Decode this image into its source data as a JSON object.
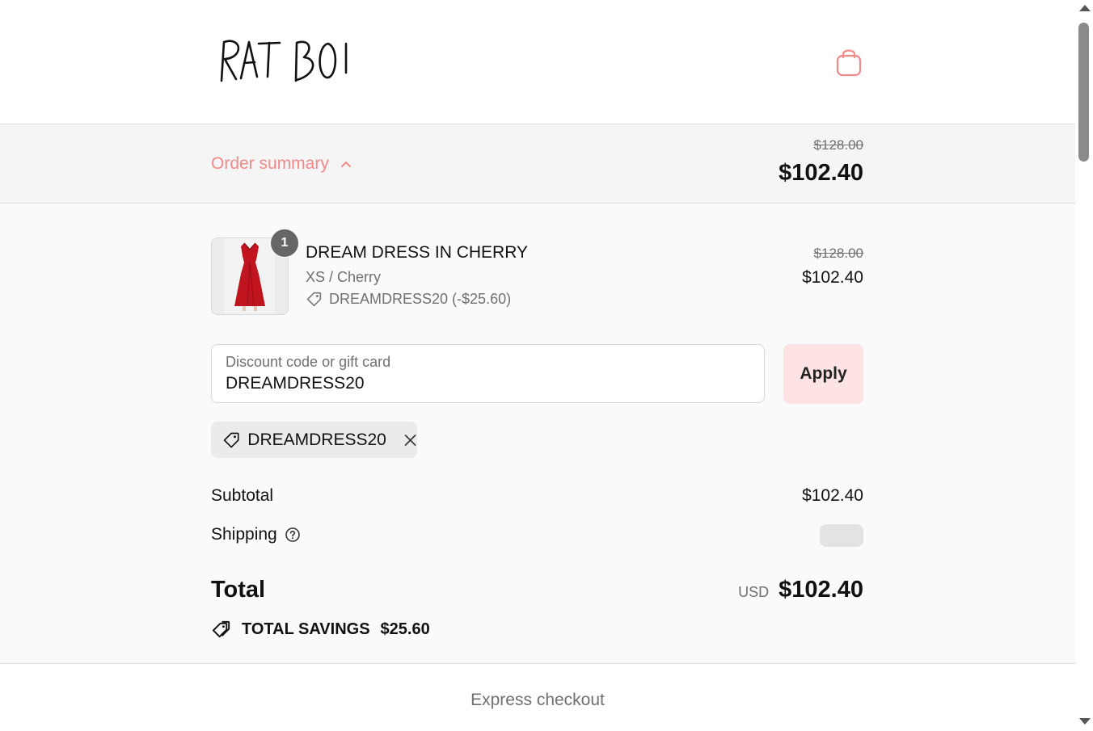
{
  "header": {
    "logo_text": "RAT BOI",
    "cart_icon": "shopping-bag-icon"
  },
  "summary_bar": {
    "toggle_label": "Order summary",
    "toggle_icon": "chevron-up-icon",
    "original_price": "$128.00",
    "price": "$102.40"
  },
  "line_item": {
    "quantity": "1",
    "name": "DREAM DRESS IN CHERRY",
    "variant": "XS / Cherry",
    "discount": "DREAMDRESS20 (-$25.60)",
    "original_price": "$128.00",
    "price": "$102.40",
    "image_icon": "red-dress-image"
  },
  "discount": {
    "label": "Discount code or gift card",
    "value": "DREAMDRESS20",
    "apply_label": "Apply",
    "applied_code": "DREAMDRESS20"
  },
  "totals": {
    "subtotal_label": "Subtotal",
    "subtotal_value": "$102.40",
    "shipping_label": "Shipping",
    "total_label": "Total",
    "currency": "USD",
    "total_value": "$102.40",
    "savings_label": "TOTAL SAVINGS",
    "savings_value": "$25.60"
  },
  "express": {
    "label": "Express checkout"
  },
  "colors": {
    "accent": "#f08a8a",
    "apply_bg": "#fde3e3",
    "summary_bg": "#fafafa"
  }
}
